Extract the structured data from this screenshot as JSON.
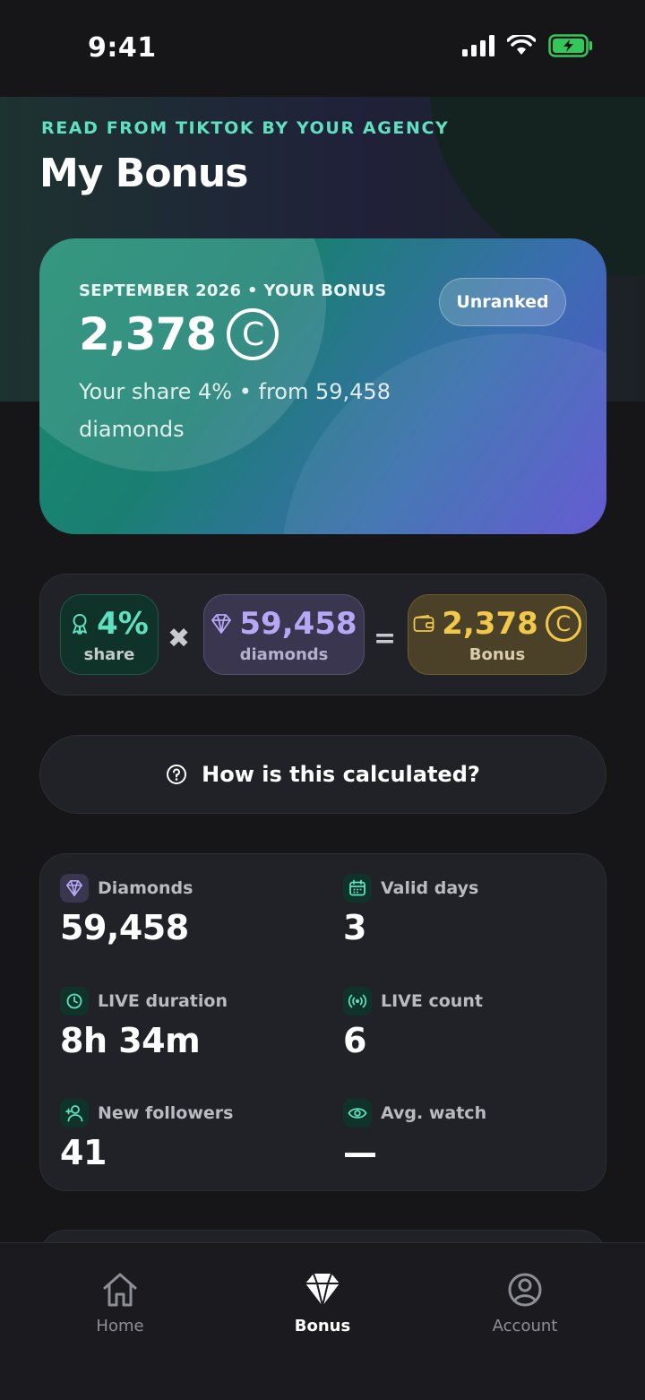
{
  "status": {
    "time": "9:41"
  },
  "header": {
    "eyebrow": "READ FROM TIKTOK BY YOUR AGENCY",
    "title": "My Bonus"
  },
  "hero": {
    "kicker": "SEPTEMBER 2026 • YOUR BONUS",
    "amount": "2,378",
    "coin_symbol": "C",
    "subtitle": "Your share 4% • from 59,458 diamonds",
    "rank_badge": "Unranked"
  },
  "formula": {
    "share": {
      "value": "4%",
      "label": "share"
    },
    "multiply": "✖",
    "diamonds": {
      "value": "59,458",
      "label": "diamonds"
    },
    "equals": "=",
    "bonus": {
      "value": "2,378",
      "coin_symbol": "C",
      "label": "Bonus"
    }
  },
  "how_button": {
    "label": "How is this calculated?"
  },
  "stats": [
    {
      "label": "Diamonds",
      "value": "59,458",
      "icon": "diamond-icon"
    },
    {
      "label": "Valid days",
      "value": "3",
      "icon": "calendar-icon"
    },
    {
      "label": "LIVE duration",
      "value": "8h 34m",
      "icon": "clock-icon"
    },
    {
      "label": "LIVE count",
      "value": "6",
      "icon": "broadcast-icon"
    },
    {
      "label": "New followers",
      "value": "41",
      "icon": "add-user-icon"
    },
    {
      "label": "Avg. watch",
      "value": "—",
      "icon": "eye-icon"
    }
  ],
  "tabs": [
    {
      "label": "Home",
      "icon": "home-icon",
      "active": false
    },
    {
      "label": "Bonus",
      "icon": "diamond-icon",
      "active": true
    },
    {
      "label": "Account",
      "icon": "account-icon",
      "active": false
    }
  ],
  "colors": {
    "accent_green": "#5fe0c0",
    "accent_purple": "#b7a8f5",
    "accent_gold": "#f2c84a",
    "background": "#161619",
    "card": "#212227"
  }
}
